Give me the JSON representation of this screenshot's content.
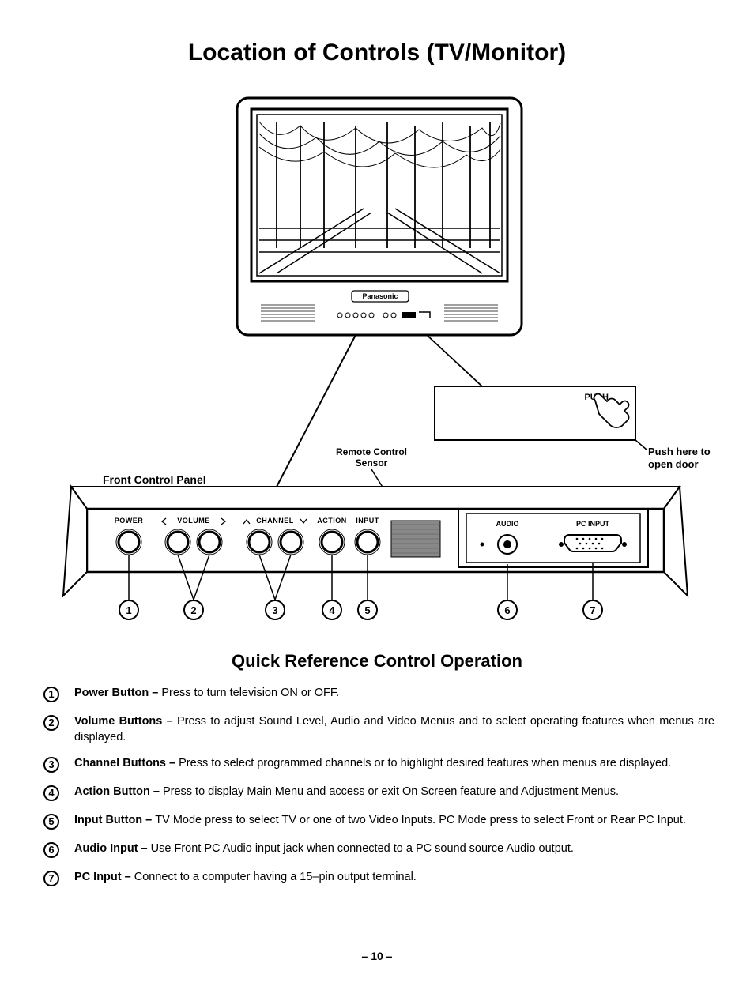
{
  "title": "Location of Controls (TV/Monitor)",
  "diagram": {
    "brand": "Panasonic",
    "push_label": "PUSH",
    "push_note_1": "Push here to",
    "push_note_2": "open door",
    "remote_sensor_1": "Remote Control",
    "remote_sensor_2": "Sensor",
    "front_panel": "Front Control Panel",
    "btn_power": "POWER",
    "btn_volume": "VOLUME",
    "btn_channel": "CHANNEL",
    "btn_action": "ACTION",
    "btn_input": "INPUT",
    "jack_audio": "AUDIO",
    "jack_pcinput": "PC INPUT",
    "callout_1": "1",
    "callout_2": "2",
    "callout_3": "3",
    "callout_4": "4",
    "callout_5": "5",
    "callout_6": "6",
    "callout_7": "7"
  },
  "subhead": "Quick Reference Control Operation",
  "items": [
    {
      "n": "1",
      "lead": "Power Button – ",
      "desc": "Press to turn television ON or OFF."
    },
    {
      "n": "2",
      "lead": "Volume Buttons – ",
      "desc": "Press to adjust Sound Level, Audio and Video Menus and to select operating features when menus are displayed."
    },
    {
      "n": "3",
      "lead": "Channel Buttons – ",
      "desc": "Press to select programmed channels or to highlight desired features when menus are displayed."
    },
    {
      "n": "4",
      "lead": "Action Button – ",
      "desc": "Press to display Main Menu and access or exit On Screen feature and Adjustment Menus."
    },
    {
      "n": "5",
      "lead": "Input Button – ",
      "desc": "TV Mode press to select TV or one of two Video Inputs. PC Mode press to select Front or Rear PC Input."
    },
    {
      "n": "6",
      "lead": "Audio Input – ",
      "desc": "Use Front PC Audio input jack when connected to a PC sound source Audio output."
    },
    {
      "n": "7",
      "lead": "PC Input – ",
      "desc": "Connect to a computer having a 15–pin output terminal."
    }
  ],
  "pagenum": "– 10 –"
}
